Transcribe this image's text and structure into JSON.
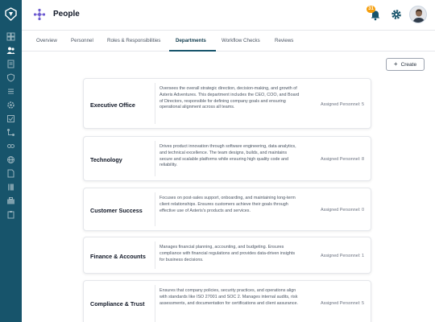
{
  "header": {
    "title": "People",
    "notification_count": "31"
  },
  "tabs": [
    {
      "label": "Overview"
    },
    {
      "label": "Personnel"
    },
    {
      "label": "Roles & Responsibilities"
    },
    {
      "label": "Departments"
    },
    {
      "label": "Workflow Checks"
    },
    {
      "label": "Reviews"
    }
  ],
  "actions": {
    "create_label": "Create"
  },
  "departments": [
    {
      "name": "Executive Office",
      "description": "Oversees the overall strategic direction, decision-making, and growth of Asteris Adventures. This department includes the CEO, COO, and Board of Directors, responsible for defining company goals and ensuring operational alignment across all teams.",
      "personnel": "Assigned Personnel: 5"
    },
    {
      "name": "Technology",
      "description": "Drives product innovation through software engineering, data analytics, and technical excellence. The team designs, builds, and maintains secure and scalable platforms while ensuring high quality code and reliability.",
      "personnel": "Assigned Personnel: 8"
    },
    {
      "name": "Customer Success",
      "description": "Focuses on post-sales support, onboarding, and maintaining long-term client relationships. Ensures customers achieve their goals through effective use of Asteris's products and services.",
      "personnel": "Assigned Personnel: 0"
    },
    {
      "name": "Finance & Accounts",
      "description": "Manages financial planning, accounting, and budgeting. Ensures compliance with financial regulations and provides data-driven insights for business decisions.",
      "personnel": "Assigned Personnel: 1"
    },
    {
      "name": "Compliance & Trust",
      "description": "Ensures that company policies, security practices, and operations align with standards like ISO 27001 and SOC 2. Manages internal audits, risk assessments, and documentation for certifications and client assurance.",
      "personnel": "Assigned Personnel: 5"
    }
  ],
  "colors": {
    "sidebar": "#17546b",
    "accent": "#17546b",
    "badge": "#f59e0b"
  }
}
